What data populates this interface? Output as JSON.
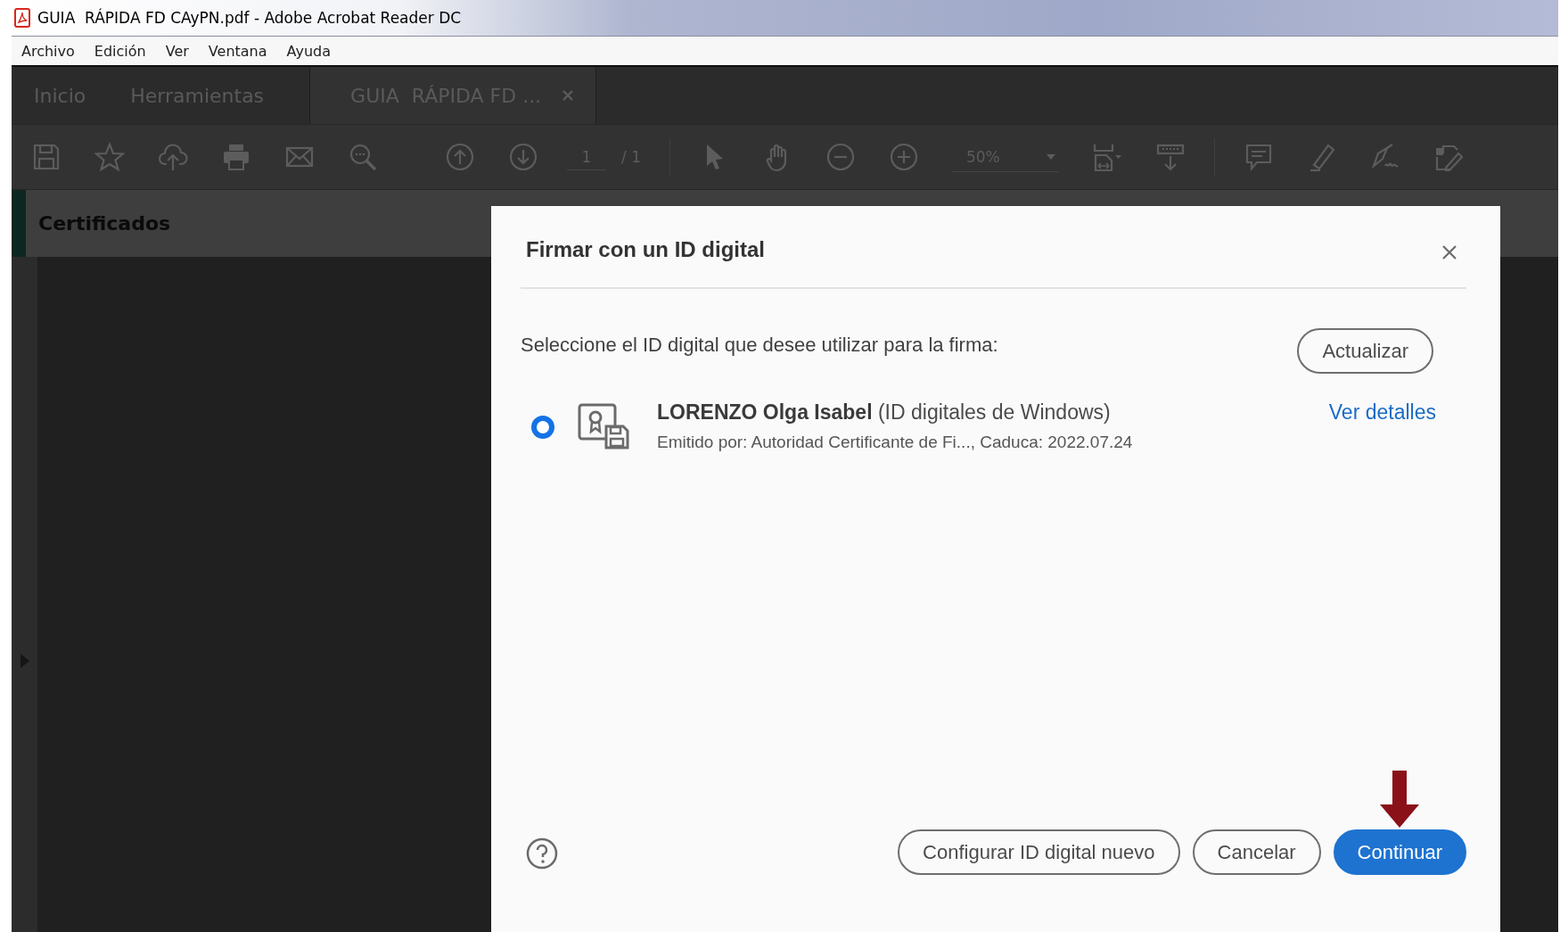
{
  "window": {
    "title": "GUIA  RÁPIDA FD CAyPN.pdf - Adobe Acrobat Reader DC"
  },
  "menu": [
    "Archivo",
    "Edición",
    "Ver",
    "Ventana",
    "Ayuda"
  ],
  "tabs": [
    {
      "label": "Inicio",
      "selected": false,
      "closable": false
    },
    {
      "label": "Herramientas",
      "selected": false,
      "closable": false
    },
    {
      "label": "GUIA  RÁPIDA FD ...",
      "selected": true,
      "closable": true
    }
  ],
  "toolbar": {
    "page": "1",
    "page_total": "/ 1",
    "zoom": "50%"
  },
  "panel": {
    "title": "Certificados"
  },
  "dialog": {
    "title": "Firmar con un ID digital",
    "prompt": "Seleccione el ID digital que desee utilizar para la firma:",
    "refresh": "Actualizar",
    "ids": [
      {
        "name": "LORENZO Olga Isabel",
        "source": "(ID digitales de Windows)",
        "issuer": "Emitido por: Autoridad Certificante de Fi..., Caduca: 2022.07.24",
        "link": "Ver detalles",
        "selected": true
      }
    ],
    "buttons": [
      {
        "label": "Configurar ID digital nuevo",
        "kind": "secondary"
      },
      {
        "label": "Cancelar",
        "kind": "secondary"
      },
      {
        "label": "Continuar",
        "kind": "primary"
      }
    ]
  }
}
